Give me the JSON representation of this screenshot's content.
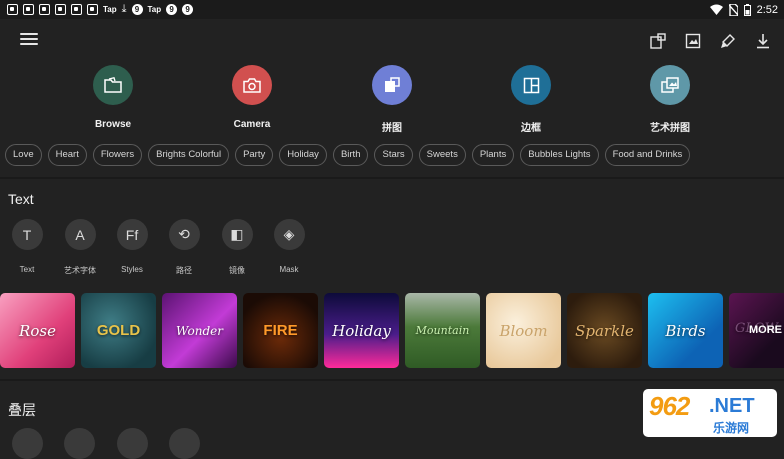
{
  "status_bar": {
    "small_label_1": "Tap",
    "small_label_2": "Tap",
    "time": "2:52"
  },
  "app_bar": {
    "icons": [
      "menu-icon",
      "collage-icon",
      "edit-image-icon",
      "brush-icon",
      "download-icon"
    ]
  },
  "quick_actions": [
    {
      "label": "Browse",
      "color": "#2e5e4e",
      "icon": "folder-icon"
    },
    {
      "label": "Camera",
      "color": "#d1504f",
      "icon": "camera-icon"
    },
    {
      "label": "拼图",
      "color": "#6f7fd6",
      "icon": "collage-icon"
    },
    {
      "label": "边框",
      "color": "#1f6f97",
      "icon": "frame-icon"
    },
    {
      "label": "艺术拼图",
      "color": "#5f98a8",
      "icon": "art-collage-icon"
    }
  ],
  "categories": [
    "Love",
    "Heart",
    "Flowers",
    "Brights Colorful",
    "Party",
    "Holiday",
    "Birth",
    "Stars",
    "Sweets",
    "Plants",
    "Bubbles Lights",
    "Food and Drinks"
  ],
  "text_section": {
    "title": "Text",
    "tools": [
      {
        "label": "Text",
        "glyph": "T",
        "icon": "text-icon"
      },
      {
        "label": "艺术字体",
        "glyph": "A",
        "icon": "art-font-icon"
      },
      {
        "label": "Styles",
        "glyph": "Ff",
        "icon": "styles-icon"
      },
      {
        "label": "路径",
        "glyph": "⟲",
        "icon": "path-icon"
      },
      {
        "label": "镜像",
        "glyph": "◧",
        "icon": "mirror-icon"
      },
      {
        "label": "Mask",
        "glyph": "◈",
        "icon": "mask-icon"
      }
    ],
    "samples": [
      {
        "text": "Rose",
        "bg": "linear-gradient(135deg,#f9a0c0,#e0407a 60%,#b01d5a)"
      },
      {
        "text": "GOLD",
        "bg": "radial-gradient(circle at 40% 40%,#3f7d86,#173d44 75%)"
      },
      {
        "text": "Wonder",
        "bg": "linear-gradient(135deg,#5b1372,#c23bd6 55%,#3b0a4a)"
      },
      {
        "text": "FIRE",
        "bg": "radial-gradient(circle at 50% 60%,#6b2a09,#1b0b05 75%)"
      },
      {
        "text": "Holiday",
        "bg": "linear-gradient(180deg,#0d0b3a,#4a1d8a 55%,#ff2a9a)"
      },
      {
        "text": "Mountain",
        "bg": "linear-gradient(180deg,#a9b7a8,#4c7a3a 45%,#2f5b25)"
      },
      {
        "text": "Bloom",
        "bg": "radial-gradient(circle at 40% 40%,#fbf0dc,#e8c89a 80%)"
      },
      {
        "text": "Sparkle",
        "bg": "radial-gradient(circle at 50% 50%,#6a4a22,#2d1c0d 80%)"
      },
      {
        "text": "Birds",
        "bg": "linear-gradient(135deg,#1dbff0,#0d63b5 70%)"
      },
      {
        "text": "GLOW",
        "bg": "linear-gradient(135deg,#5b1451,#1a0a1e 70%)"
      }
    ],
    "more_label": "MORE"
  },
  "layer_section": {
    "title": "叠层"
  },
  "watermark": {
    "number": "962",
    "net": ".NET",
    "sub": "乐游网"
  }
}
